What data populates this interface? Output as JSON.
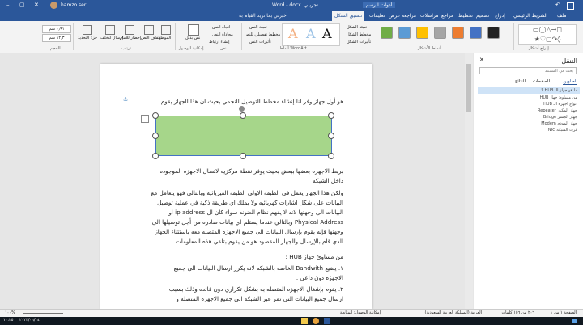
{
  "titlebar": {
    "title": "Word - docx. تجريبي",
    "user": "hamzo ser",
    "search_placeholder": "أخبرني بما تريد القيام به",
    "tools_context": "أدوات الرسم"
  },
  "tabs": [
    {
      "label": "ملف"
    },
    {
      "label": "الشريط الرئيسي"
    },
    {
      "label": "إدراج"
    },
    {
      "label": "تصميم"
    },
    {
      "label": "تخطيط"
    },
    {
      "label": "مراجع"
    },
    {
      "label": "مراسلات"
    },
    {
      "label": "مراجعة"
    },
    {
      "label": "عرض"
    },
    {
      "label": "تعليمات"
    },
    {
      "label": "تنسيق الشكل"
    }
  ],
  "active_tab": "تنسيق الشكل",
  "ribbon": {
    "groups": [
      {
        "label": "إدراج أشكال"
      },
      {
        "label": "أنماط الأشكال"
      },
      {
        "label": "أنماط WordArt"
      },
      {
        "label": "نص"
      },
      {
        "label": "إمكانية الوصول"
      },
      {
        "label": "ترتيب"
      },
      {
        "label": "الحجم"
      }
    ],
    "shape_fill": "تعبئة الشكل",
    "shape_outline": "مخطط الشكل",
    "shape_effects": "تأثيرات الشكل",
    "wordart_fill": "تعبئة النص",
    "wordart_outline": "مخطط تفصيلي للنص",
    "wordart_effects": "تأثيرات النص",
    "text_direction": "اتجاه النص",
    "align_text": "محاذاة النص",
    "create_link": "إنشاء ارتباط",
    "alt_text": "نص بديل",
    "position": "الموضع",
    "wrap_text": "التفاف النص",
    "bring_forward": "إحضار للأمام",
    "send_backward": "إرسال للخلف",
    "selection_pane": "جزء التحديد",
    "height_value": "٠٫٩١ سم",
    "width_value": "١٢٫٣ سم",
    "style_colors": [
      "#222222",
      "#4472c4",
      "#ed7d31",
      "#a5a5a5",
      "#ffc000",
      "#5b9bd5",
      "#70ad47"
    ],
    "wordart_letters": [
      "A",
      "A",
      "A"
    ]
  },
  "document": {
    "lines": [
      "هو أول جهاز وفر لنا إنشاء مخطط التوصيل النجمي بحيث ان هذا الجهاز يقوم",
      "بربط الاجهزه بعضها ببعض بحيث يوفر نقطة مركزيه لاتصال الاجهزه الموجوده",
      "داخل الشبكه",
      "ولكن هذا الجهاز يعمل في الطبقة الاولى الطبقة الفيزيائيه وبالتالي فهو يتعامل مع",
      "البيانات على شكل اشارات كهربائيه ولا يملك اي طريقة ذكية في عملية توصيل",
      "البيانات الى وجهتها لانه لا يفهم نظام العنونه سواء كان ال ip address او",
      "Physical Address وبالتالي عندما يستلم اي بيانات صادره من أجل توصيلها الى",
      "وجهتها فإنه يقوم بإرسال البيانات الى جميع الاجهزه المتصله معه باستثناء الجهاز",
      "الذي قام بالإرسال والجهاز المقصود هو من يقوم بتلقي هذه المعلومات .",
      "من مساوئ جهاز HUB :",
      "١. يضيع Bandwith الخاصه بالشبكه لانه يكرر ارسال البيانات الى جميع",
      "الاجهزه دون داعي .",
      "٢. يقوم بإشغال الاجهزه المتصله به بشكل تكراري دون فائده وذلك بسبب",
      "ارسال جميع البيانات التي تمر عبر الشبكه الى جميع الاجهزه المتصله و"
    ],
    "shape_fill": "#a6d68a",
    "shape_border": "#4472c4"
  },
  "nav_pane": {
    "title": "التنقل",
    "search_placeholder": "بحث في المستند",
    "tabs": [
      "العناوين",
      "الصفحات",
      "النتائج"
    ],
    "items": [
      "ما هو جهاز الـ HUB ؟",
      "من مساوئ جهاز HUB",
      "انواع اجهزة الـ HUB",
      "جهاز المكرر Repeater",
      "جهاز الجسر Bridge",
      "جهاز المودم Modem",
      "كرت الشبكة NIC"
    ]
  },
  "statusbar": {
    "page": "الصفحة ١ من ١",
    "words": "٢٠٦ من ١٥٦ كلمات",
    "language": "العربية (المملكة العربية السعودية)",
    "accessibility": "إمكانية الوصول: المتابعة",
    "zoom": "١٠٠%"
  },
  "taskbar": {
    "time": "١٠:٢٥",
    "date": "٢٠٢٣/٠٦/٠٤"
  }
}
